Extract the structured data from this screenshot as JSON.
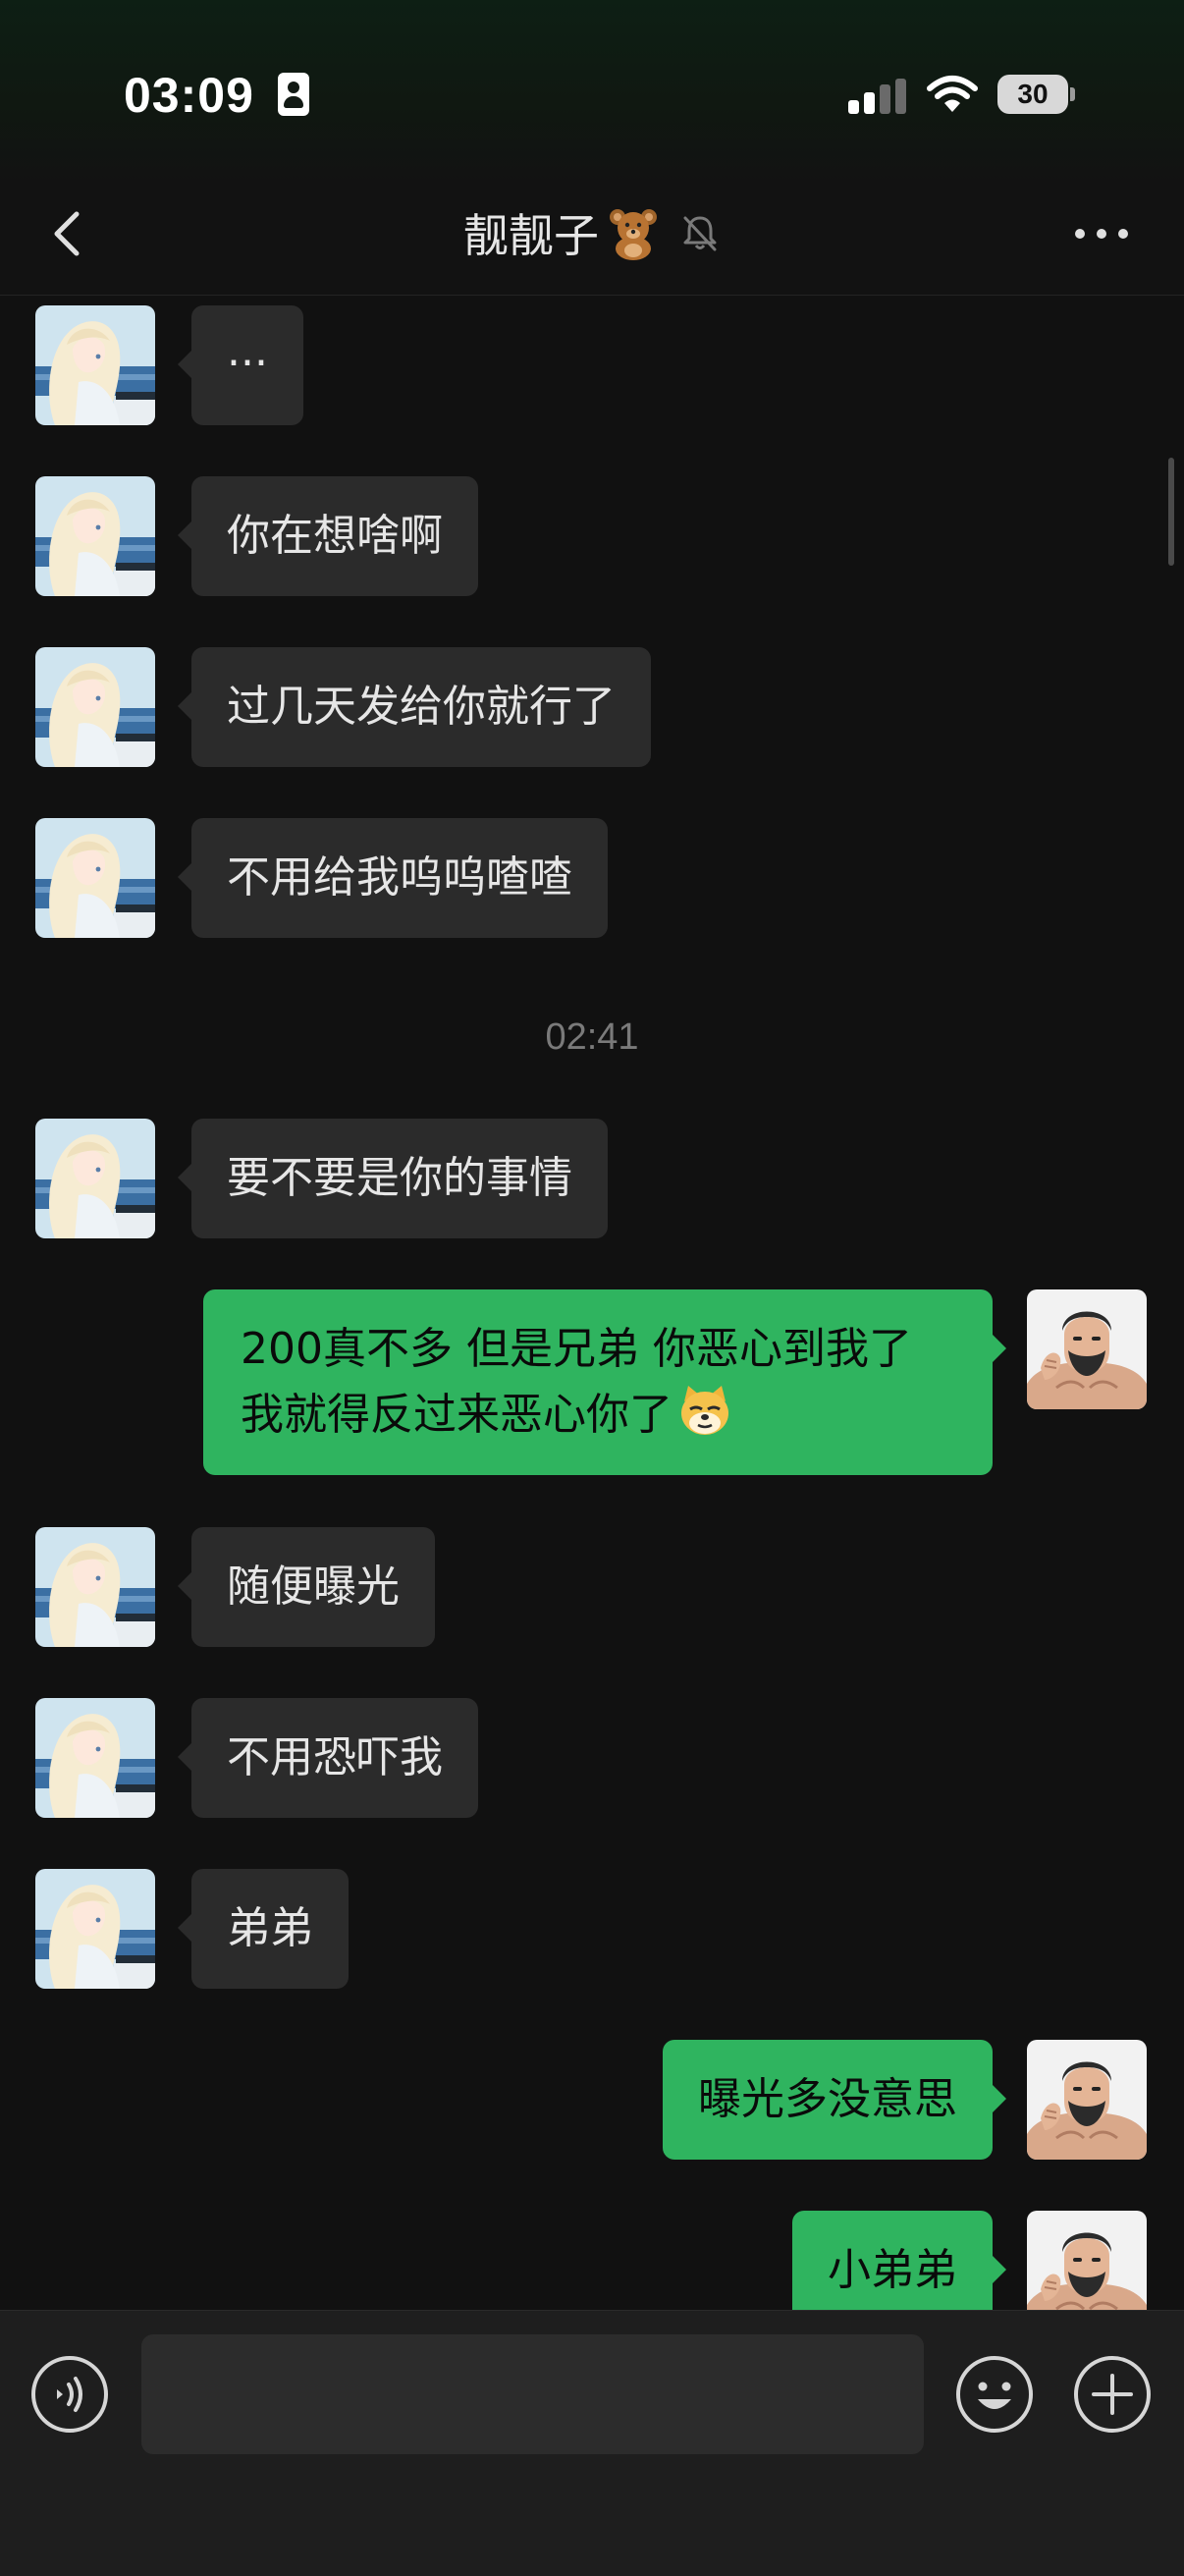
{
  "status_bar": {
    "time": "03:09",
    "battery": "30",
    "icons": [
      "id-card-icon",
      "signal-icon",
      "wifi-icon",
      "battery-icon"
    ]
  },
  "nav": {
    "title": "靓靓子",
    "icons": [
      "back-chevron-icon",
      "teddy-bear-icon",
      "bell-muted-icon",
      "more-dots-icon"
    ]
  },
  "messages": [
    {
      "side": "left",
      "text": "..."
    },
    {
      "side": "left",
      "text": "你在想啥啊"
    },
    {
      "side": "left",
      "text": "过几天发给你就行了"
    },
    {
      "side": "left",
      "text": "不用给我呜呜喳喳"
    },
    {
      "type": "timestamp",
      "text": "02:41"
    },
    {
      "side": "left",
      "text": "要不要是你的事情"
    },
    {
      "side": "right",
      "text": "200真不多 但是兄弟 你恶心到我了 我就得反过来恶心你了",
      "emoji": "cat-emoji"
    },
    {
      "side": "left",
      "text": "随便曝光"
    },
    {
      "side": "left",
      "text": "不用恐吓我"
    },
    {
      "side": "left",
      "text": "弟弟"
    },
    {
      "side": "right",
      "text": "曝光多没意思"
    },
    {
      "side": "right",
      "text": "小弟弟"
    }
  ],
  "input_bar": {
    "placeholder": "",
    "icons": [
      "voice-icon",
      "emoji-face-icon",
      "plus-icon"
    ]
  },
  "colors": {
    "background": "#111111",
    "incoming_bubble": "#2b2b2b",
    "outgoing_bubble": "#2fb45f",
    "input_bar": "#1e1e1e"
  }
}
